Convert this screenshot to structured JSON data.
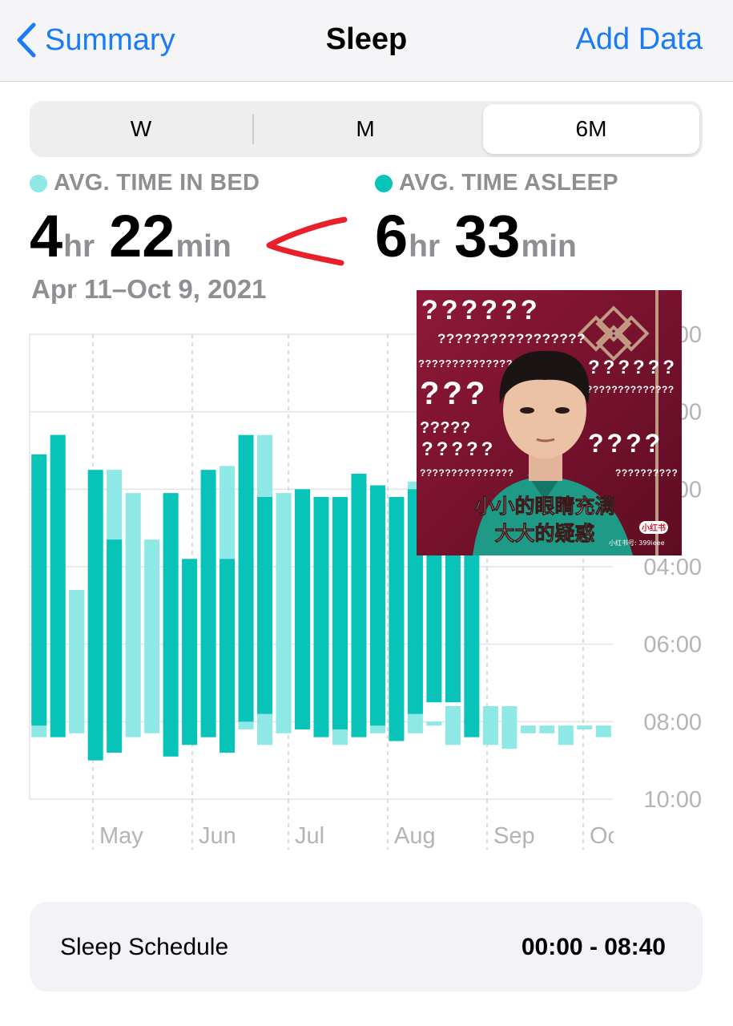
{
  "nav": {
    "back_label": "Summary",
    "title": "Sleep",
    "action_label": "Add Data"
  },
  "segments": {
    "items": [
      "W",
      "M",
      "6M"
    ],
    "selected": "6M"
  },
  "stats": {
    "in_bed": {
      "label": "AVG. TIME IN BED",
      "hours": "4",
      "hours_unit": "hr",
      "minutes": "22",
      "minutes_unit": "min"
    },
    "asleep": {
      "label": "AVG. TIME ASLEEP",
      "hours": "6",
      "hours_unit": "hr",
      "minutes": "33",
      "minutes_unit": "min"
    },
    "date_range": "Apr 11–Oct 9, 2021"
  },
  "colors": {
    "in_bed": "#8de8e6",
    "asleep": "#08c4b8",
    "accent": "#1a7cf5",
    "annotation": "#e8202a"
  },
  "chart_data": {
    "type": "bar",
    "y_axis": {
      "tick_labels": [
        "00",
        "00",
        "00",
        "04:00",
        "06:00",
        "08:00",
        "10:00"
      ],
      "ticks_hours": [
        -2,
        0,
        2,
        4,
        6,
        8,
        10
      ],
      "range_hours": [
        -2,
        10
      ],
      "position": "right",
      "note": "hours relative to midnight; earlier times at top"
    },
    "x_axis": {
      "tick_labels": [
        "May",
        "Jun",
        "Jul",
        "Aug",
        "Sep",
        "Oc"
      ]
    },
    "series": [
      {
        "key": "in_bed",
        "values": [
          [
            1.1,
            8.4
          ],
          [
            0.6,
            8.2
          ],
          [
            4.6,
            8.3
          ],
          [
            2.5,
            8.4
          ],
          [
            1.5,
            8.3
          ],
          [
            2.1,
            8.4
          ],
          [
            3.3,
            8.3
          ],
          [
            2.1,
            8.8
          ],
          [
            3.8,
            8.2
          ],
          [
            2.4,
            8.4
          ],
          [
            1.4,
            8.6
          ],
          [
            3.9,
            8.2
          ],
          [
            0.6,
            8.6
          ],
          [
            2.1,
            8.3
          ],
          [
            6.5,
            8.1
          ],
          [
            3.2,
            8.2
          ],
          [
            2.2,
            8.6
          ],
          [
            2.2,
            8.3
          ],
          [
            2.2,
            8.3
          ],
          [
            5.2,
            8.5
          ],
          [
            1.8,
            8.3
          ],
          [
            8.0,
            8.1
          ],
          [
            7.6,
            8.6
          ],
          [
            7.6,
            8.3
          ],
          [
            7.6,
            8.6
          ],
          [
            7.6,
            8.7
          ],
          [
            8.1,
            8.3
          ],
          [
            8.1,
            8.3
          ],
          [
            8.1,
            8.6
          ],
          [
            8.1,
            8.2
          ],
          [
            8.1,
            8.4
          ]
        ]
      },
      {
        "key": "asleep",
        "values": [
          [
            1.1,
            8.1
          ],
          [
            0.6,
            8.4
          ],
          null,
          [
            1.5,
            9.0
          ],
          [
            3.3,
            8.8
          ],
          null,
          null,
          [
            2.1,
            8.9
          ],
          [
            3.8,
            8.6
          ],
          [
            1.5,
            8.4
          ],
          [
            3.8,
            8.8
          ],
          [
            0.6,
            8.0
          ],
          [
            2.2,
            7.8
          ],
          null,
          [
            2.0,
            8.2
          ],
          [
            2.2,
            8.4
          ],
          [
            2.2,
            8.2
          ],
          [
            1.6,
            8.4
          ],
          [
            1.9,
            8.1
          ],
          [
            2.2,
            8.5
          ],
          [
            2.0,
            7.8
          ],
          [
            2.0,
            7.5
          ],
          [
            2.0,
            7.5
          ],
          [
            2.0,
            8.4
          ],
          null,
          null,
          null,
          null,
          null,
          null,
          null
        ]
      }
    ]
  },
  "annotation": {
    "arrow": "less-than sign drawn in red between the two stats"
  },
  "meme": {
    "question_rows": [
      "??????",
      "?????????????????",
      "???????????????",
      "???",
      "?????",
      "??????????????",
      "??????",
      "?????",
      "????",
      "???????????????",
      "??????????"
    ],
    "caption_line1": "小小的眼睛充满",
    "caption_line2": "大大的疑惑",
    "badge": "小红书",
    "watermark": "小红书号: 399ieee"
  },
  "schedule": {
    "label": "Sleep Schedule",
    "value": "00:00 - 08:40"
  }
}
